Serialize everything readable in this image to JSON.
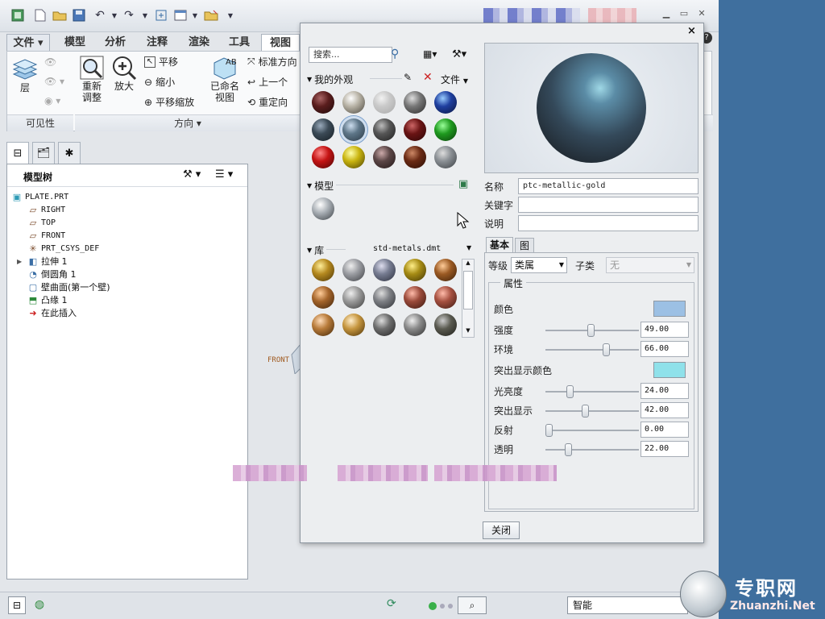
{
  "ribbon": {
    "tabs": [
      "文件",
      "模型",
      "分析",
      "注释",
      "渲染",
      "工具",
      "视图"
    ],
    "layer_label": "层",
    "refit_label_1": "重新",
    "refit_label_2": "调整",
    "zoom_in_label": "放大",
    "pan_label": "平移",
    "zoom_out_label": "缩小",
    "pan_zoom_label": "平移缩放",
    "named_views_label_1": "已命名",
    "named_views_label_2": "视图",
    "standard_orientation_label": "标准方向",
    "previous_label": "上一个",
    "reorient_label": "重定向",
    "visibility_group": "可见性",
    "orientation_group": "方向"
  },
  "model_tree": {
    "title": "模型树",
    "items": [
      {
        "label": "PLATE.PRT",
        "icon": "part-icon"
      },
      {
        "label": "RIGHT",
        "icon": "datum-plane-icon"
      },
      {
        "label": "TOP",
        "icon": "datum-plane-icon"
      },
      {
        "label": "FRONT",
        "icon": "datum-plane-icon"
      },
      {
        "label": "PRT_CSYS_DEF",
        "icon": "csys-icon"
      },
      {
        "label": "拉伸 1",
        "icon": "extrude-icon"
      },
      {
        "label": "倒圆角 1",
        "icon": "round-icon"
      },
      {
        "label": "壁曲面(第一个壁)",
        "icon": "wall-icon"
      },
      {
        "label": "凸缘 1",
        "icon": "flange-icon"
      },
      {
        "label": "在此插入",
        "icon": "insert-arrow-icon"
      }
    ]
  },
  "canvas": {
    "front_label": "FRONT"
  },
  "status_bar": {
    "filter_value": "智能"
  },
  "dialog": {
    "search_placeholder": "搜索...",
    "my_appearances_label": "我的外观",
    "file_menu_label": "文件",
    "model_label": "模型",
    "library_label": "库",
    "library_file": "std-metals.dmt",
    "name_label": "名称",
    "name_value": "ptc-metallic-gold",
    "keyword_label": "关键字",
    "keyword_value": "",
    "description_label": "说明",
    "description_value": "",
    "tabs": [
      "基本",
      "图"
    ],
    "class_label": "等级",
    "class_value": "类属",
    "subclass_label": "子类",
    "subclass_value": "无",
    "properties_label": "属性",
    "color_label": "颜色",
    "highlight_color_label": "突出显示颜色",
    "sliders": [
      {
        "label": "强度",
        "value": "49.00",
        "fraction": 0.49
      },
      {
        "label": "环境",
        "value": "66.00",
        "fraction": 0.66
      },
      {
        "label": "光亮度",
        "value": "24.00",
        "fraction": 0.24
      },
      {
        "label": "突出显示",
        "value": "42.00",
        "fraction": 0.42
      },
      {
        "label": "反射",
        "value": "0.00",
        "fraction": 0.0
      },
      {
        "label": "透明",
        "value": "22.00",
        "fraction": 0.22
      }
    ],
    "close_button": "关闭"
  },
  "colors": {
    "color_swatch": "#9cc0e4",
    "highlight_swatch": "#8fe1ea",
    "ribbon_accent": "#2c5f95"
  },
  "watermark": {
    "cn": "专职网",
    "en": "Zhuanzhi.Net"
  }
}
